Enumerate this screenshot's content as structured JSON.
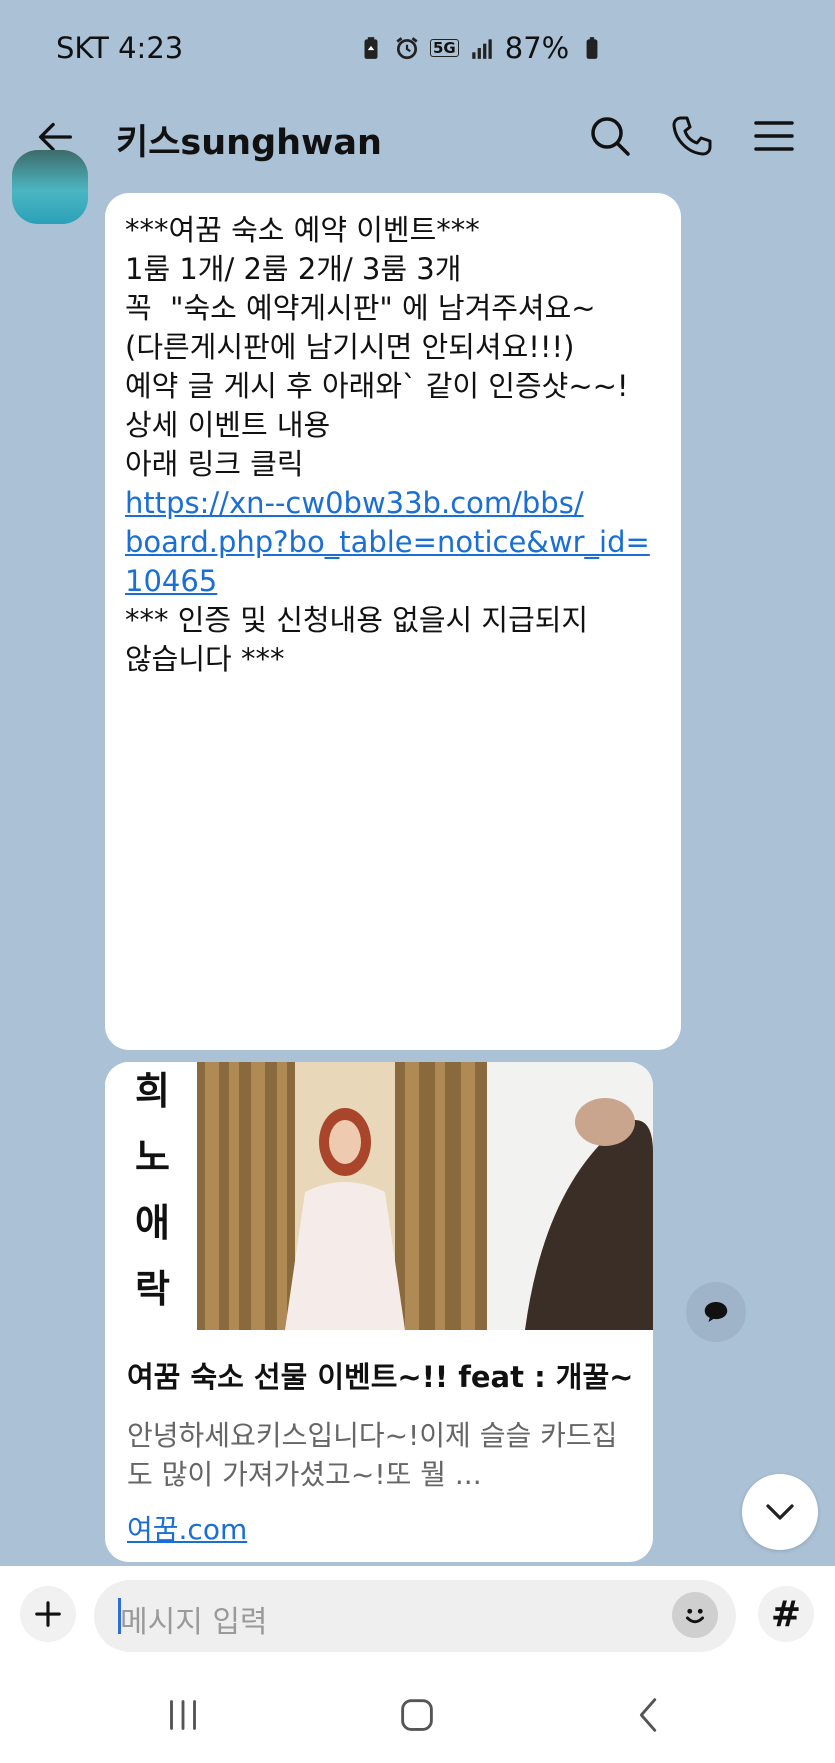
{
  "status_bar": {
    "carrier_time": "SKT 4:23",
    "network": "5G",
    "battery": "87%",
    "icons": [
      "battery-saver-icon",
      "alarm-icon",
      "5g-icon",
      "signal-icon",
      "battery-icon"
    ]
  },
  "header": {
    "title": "키스sunghwan",
    "icons": [
      "back-arrow-icon",
      "search-icon",
      "phone-icon",
      "menu-icon"
    ]
  },
  "message": {
    "lines": [
      "***여꿈 숙소 예약 이벤트***",
      "",
      "",
      "1룸 1개/ 2룸 2개/ 3룸 3개",
      "",
      "꼭  \"숙소 예약게시판\" 에 남겨주셔요~",
      "(다른게시판에 남기시면 안되셔요!!!)",
      "",
      "예약 글 게시 후 아래와` 같이 인증샷~~!",
      "",
      "상세 이벤트 내용",
      "",
      "아래 링크 클릭",
      ""
    ],
    "link_lines": [
      "https://xn--cw0bw33b.com/bbs/",
      "board.php?bo_table=notice&wr_id=",
      "10465"
    ],
    "footer_lines": [
      "",
      "*** 인증 및 신청내용 없을시 지급되지",
      "않습니다 ***"
    ]
  },
  "link_preview": {
    "image_text": [
      "희",
      "노",
      "애",
      "락"
    ],
    "title": "여꿈 숙소 선물 이벤트~!! feat : 개꿀~",
    "description": "안녕하세요키스입니다~!이제 슬슬 카드집도 많이 가져가셨고~!또 뭘 ...",
    "domain": "여꿈.com"
  },
  "input": {
    "placeholder": "메시지 입력",
    "hash_label": "#"
  },
  "colors": {
    "chat_background": "#abc1d6",
    "link": "#1a6fd6",
    "bubble": "#ffffff"
  }
}
